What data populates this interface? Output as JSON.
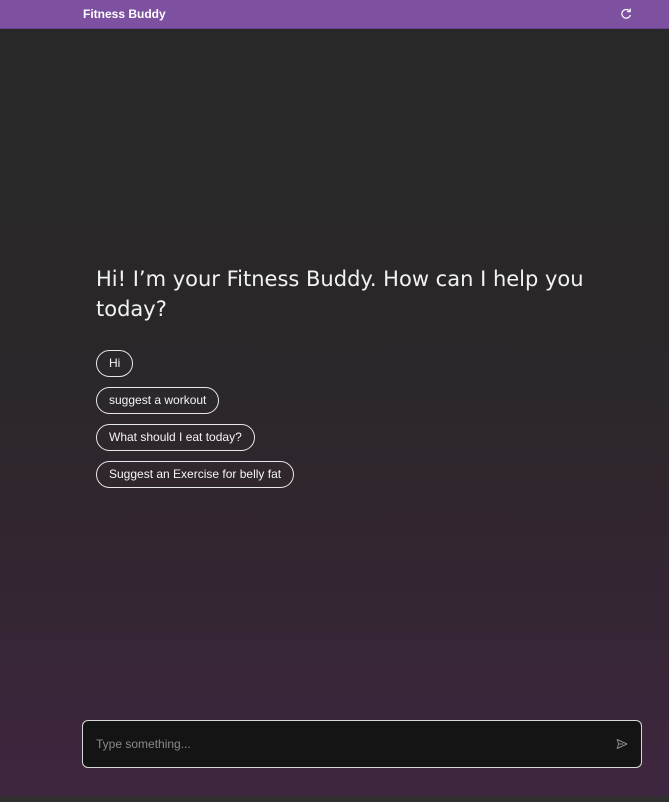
{
  "header": {
    "title": "Fitness Buddy",
    "refresh_icon": "refresh-icon",
    "background": "#7e50a0"
  },
  "chat": {
    "greeting": "Hi! I’m your Fitness Buddy. How can I help you today?",
    "suggestions": [
      "Hi",
      "suggest a workout",
      "What should I eat today?",
      "Suggest an Exercise for belly fat"
    ]
  },
  "composer": {
    "placeholder": "Type something...",
    "value": "",
    "send_icon": "send-icon"
  },
  "colors": {
    "accent": "#7e50a0",
    "background_top": "#282828",
    "background_bottom": "#3f2640",
    "text": "#f2f2f2"
  }
}
